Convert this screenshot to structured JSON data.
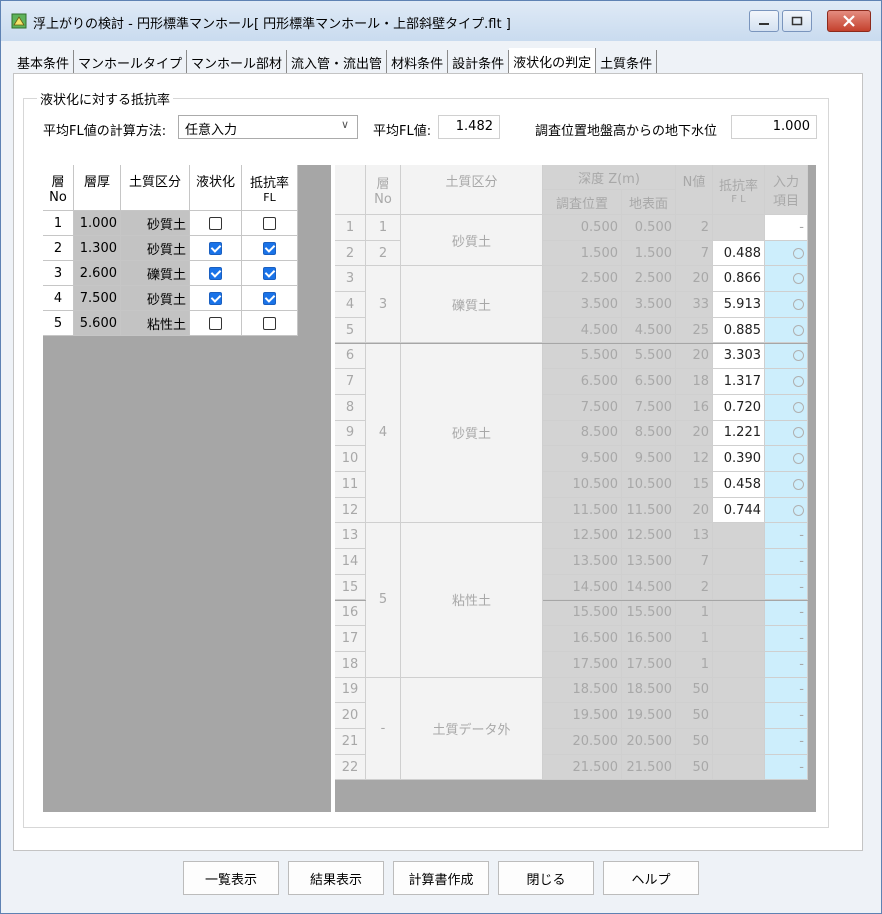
{
  "window": {
    "title": "浮上がりの検討 - 円形標準マンホール[ 円形標準マンホール・上部斜壁タイプ.flt ]"
  },
  "tabs": [
    {
      "label": "基本条件"
    },
    {
      "label": "マンホールタイプ"
    },
    {
      "label": "マンホール部材"
    },
    {
      "label": "流入管・流出管"
    },
    {
      "label": "材料条件"
    },
    {
      "label": "設計条件"
    },
    {
      "label": "液状化の判定",
      "active": true
    },
    {
      "label": "土質条件"
    }
  ],
  "group": {
    "title": "液状化に対する抵抗率",
    "method_label": "平均FL値の計算方法:",
    "method_value": "任意入力",
    "avg_fl_label": "平均FL値:",
    "avg_fl_value": "1.482",
    "water_label": "調査位置地盤高からの地下水位",
    "water_value": "1.000"
  },
  "left_table": {
    "headers": {
      "no_top": "層",
      "no_bottom": "No",
      "thick": "層厚",
      "soil": "土質区分",
      "liq": "液状化",
      "fl_top": "抵抗率",
      "fl_bottom": "FL"
    },
    "rows": [
      {
        "no": "1",
        "thick": "1.000",
        "soil": "砂質土",
        "liq": false,
        "fl": false
      },
      {
        "no": "2",
        "thick": "1.300",
        "soil": "砂質土",
        "liq": true,
        "fl": true
      },
      {
        "no": "3",
        "thick": "2.600",
        "soil": "礫質土",
        "liq": true,
        "fl": true
      },
      {
        "no": "4",
        "thick": "7.500",
        "soil": "砂質土",
        "liq": true,
        "fl": true
      },
      {
        "no": "5",
        "thick": "5.600",
        "soil": "粘性土",
        "liq": false,
        "fl": false
      }
    ]
  },
  "right_table": {
    "headers": {
      "layer_top": "層",
      "layer_bottom": "No",
      "soil": "土質区分",
      "depth": "深度 Z(m)",
      "survey": "調査位置",
      "surface": "地表面",
      "n": "N値",
      "fl_top": "抵抗率",
      "fl_bottom": "F L",
      "input_top": "入力",
      "input_bottom": "項目"
    },
    "groups": [
      {
        "layer": "1",
        "soil": "砂質土",
        "span": 2
      },
      {
        "layer": "2",
        "soil": "",
        "span": 0
      },
      {
        "layer": "3",
        "soil": "礫質土",
        "span": 3
      },
      {
        "layer": "4",
        "soil": "砂質土",
        "span": 7
      },
      {
        "layer": "5",
        "soil": "粘性土",
        "span": 6
      },
      {
        "layer": "-",
        "soil": "土質データ外",
        "span": 4
      }
    ],
    "rows": [
      {
        "idx": "1",
        "survey": "0.500",
        "surface": "0.500",
        "n": "2",
        "fl": "",
        "input": "-",
        "state": "white"
      },
      {
        "idx": "2",
        "survey": "1.500",
        "surface": "1.500",
        "n": "7",
        "fl": "0.488",
        "input": "○",
        "state": "fl"
      },
      {
        "idx": "3",
        "survey": "2.500",
        "surface": "2.500",
        "n": "20",
        "fl": "0.866",
        "input": "○",
        "state": "fl"
      },
      {
        "idx": "4",
        "survey": "3.500",
        "surface": "3.500",
        "n": "33",
        "fl": "5.913",
        "input": "○",
        "state": "fl"
      },
      {
        "idx": "5",
        "survey": "4.500",
        "surface": "4.500",
        "n": "25",
        "fl": "0.885",
        "input": "○",
        "state": "fl"
      },
      {
        "idx": "6",
        "survey": "5.500",
        "surface": "5.500",
        "n": "20",
        "fl": "3.303",
        "input": "○",
        "state": "fl"
      },
      {
        "idx": "7",
        "survey": "6.500",
        "surface": "6.500",
        "n": "18",
        "fl": "1.317",
        "input": "○",
        "state": "fl"
      },
      {
        "idx": "8",
        "survey": "7.500",
        "surface": "7.500",
        "n": "16",
        "fl": "0.720",
        "input": "○",
        "state": "fl"
      },
      {
        "idx": "9",
        "survey": "8.500",
        "surface": "8.500",
        "n": "20",
        "fl": "1.221",
        "input": "○",
        "state": "fl"
      },
      {
        "idx": "10",
        "survey": "9.500",
        "surface": "9.500",
        "n": "12",
        "fl": "0.390",
        "input": "○",
        "state": "fl"
      },
      {
        "idx": "11",
        "survey": "10.500",
        "surface": "10.500",
        "n": "15",
        "fl": "0.458",
        "input": "○",
        "state": "fl"
      },
      {
        "idx": "12",
        "survey": "11.500",
        "surface": "11.500",
        "n": "20",
        "fl": "0.744",
        "input": "○",
        "state": "fl"
      },
      {
        "idx": "13",
        "survey": "12.500",
        "surface": "12.500",
        "n": "13",
        "fl": "",
        "input": "-",
        "state": "blue"
      },
      {
        "idx": "14",
        "survey": "13.500",
        "surface": "13.500",
        "n": "7",
        "fl": "",
        "input": "-",
        "state": "blue"
      },
      {
        "idx": "15",
        "survey": "14.500",
        "surface": "14.500",
        "n": "2",
        "fl": "",
        "input": "-",
        "state": "blue"
      },
      {
        "idx": "16",
        "survey": "15.500",
        "surface": "15.500",
        "n": "1",
        "fl": "",
        "input": "-",
        "state": "blue"
      },
      {
        "idx": "17",
        "survey": "16.500",
        "surface": "16.500",
        "n": "1",
        "fl": "",
        "input": "-",
        "state": "blue"
      },
      {
        "idx": "18",
        "survey": "17.500",
        "surface": "17.500",
        "n": "1",
        "fl": "",
        "input": "-",
        "state": "blue"
      },
      {
        "idx": "19",
        "survey": "18.500",
        "surface": "18.500",
        "n": "50",
        "fl": "",
        "input": "-",
        "state": "blue"
      },
      {
        "idx": "20",
        "survey": "19.500",
        "surface": "19.500",
        "n": "50",
        "fl": "",
        "input": "-",
        "state": "blue"
      },
      {
        "idx": "21",
        "survey": "20.500",
        "surface": "20.500",
        "n": "50",
        "fl": "",
        "input": "-",
        "state": "blue"
      },
      {
        "idx": "22",
        "survey": "21.500",
        "surface": "21.500",
        "n": "50",
        "fl": "",
        "input": "-",
        "state": "blue"
      }
    ]
  },
  "buttons": {
    "list": "一覧表示",
    "result": "結果表示",
    "report": "計算書作成",
    "close": "閉じる",
    "help": "ヘルプ"
  },
  "colors": {
    "title_bar": "#c9dbef",
    "close_button": "#c4412d",
    "checkbox_on": "#1a73e8",
    "input_col_blue": "#cdeefc",
    "grid_gray": "#d3d3d3"
  }
}
